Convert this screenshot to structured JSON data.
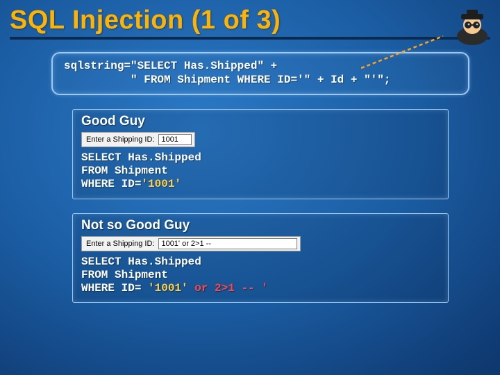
{
  "title": "SQL Injection (1 of 3)",
  "code": {
    "line1": "sqlstring=\"SELECT Has.Shipped\" +",
    "line2": "          \" FROM Shipment WHERE ID='\" + Id + \"'\";"
  },
  "good": {
    "heading": "Good Guy",
    "form_label": "Enter a Shipping ID:",
    "form_value": "1001",
    "sql_l1": "SELECT Has.Shipped",
    "sql_l2": "FROM Shipment",
    "sql_l3_a": "WHERE ID=",
    "sql_l3_b": "'1001'"
  },
  "bad": {
    "heading": "Not so Good Guy",
    "form_label": "Enter a Shipping ID:",
    "form_value": "1001' or 2>1 --",
    "sql_l1": "SELECT Has.Shipped",
    "sql_l2": "FROM Shipment",
    "sql_l3_a": "WHERE ID= ",
    "sql_l3_b": "'1001'",
    "sql_l3_c": " or 2>1 -- '"
  }
}
